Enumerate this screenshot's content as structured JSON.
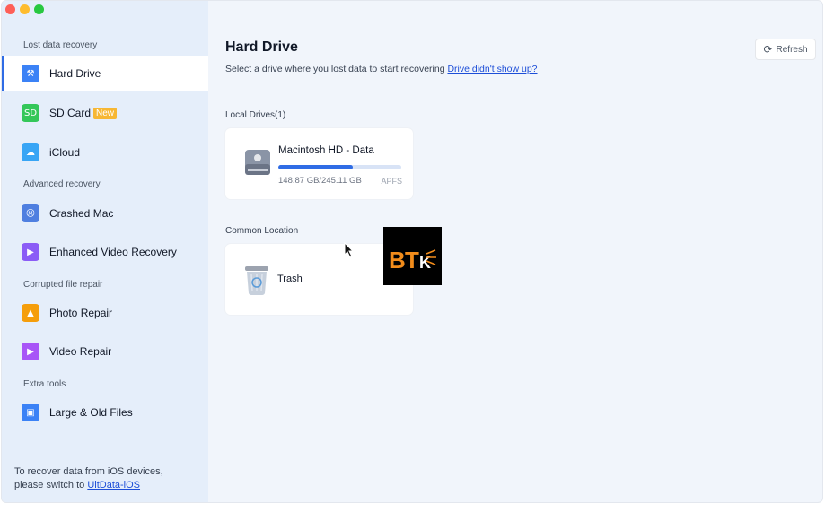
{
  "sidebar": {
    "sections": [
      {
        "title": "Lost data recovery"
      },
      {
        "title": "Advanced recovery"
      },
      {
        "title": "Corrupted file repair"
      },
      {
        "title": "Extra tools"
      }
    ],
    "items": [
      {
        "label": "Hard Drive",
        "icon": "hard-drive-icon",
        "active": true
      },
      {
        "label": "SD Card",
        "icon": "sd-card-icon",
        "badge": "New"
      },
      {
        "label": "iCloud",
        "icon": "icloud-icon"
      },
      {
        "label": "Crashed Mac",
        "icon": "crashed-mac-icon"
      },
      {
        "label": "Enhanced Video Recovery",
        "icon": "video-recovery-icon"
      },
      {
        "label": "Photo Repair",
        "icon": "photo-repair-icon"
      },
      {
        "label": "Video Repair",
        "icon": "video-repair-icon"
      },
      {
        "label": "Large & Old Files",
        "icon": "large-files-icon"
      }
    ],
    "footer": {
      "line1": "To recover data from iOS devices,",
      "line2_prefix": "please switch to ",
      "link": "UltData-iOS"
    }
  },
  "main": {
    "title": "Hard Drive",
    "subtitle": "Select a drive where you lost data to start recovering ",
    "subtitle_link": "Drive didn't show up?",
    "refresh_label": "Refresh",
    "local_drives_label": "Local Drives(1)",
    "drive": {
      "name": "Macintosh HD - Data",
      "size": "148.87 GB/245.11 GB",
      "filesystem": "APFS",
      "used_fraction": 0.607
    },
    "common_location_label": "Common Location",
    "trash_label": "Trash"
  },
  "colors": {
    "accent": "#2f6ce5",
    "sidebar_bg": "#e5eefa",
    "main_bg": "#f1f5fb",
    "badge": "#f7b733"
  }
}
